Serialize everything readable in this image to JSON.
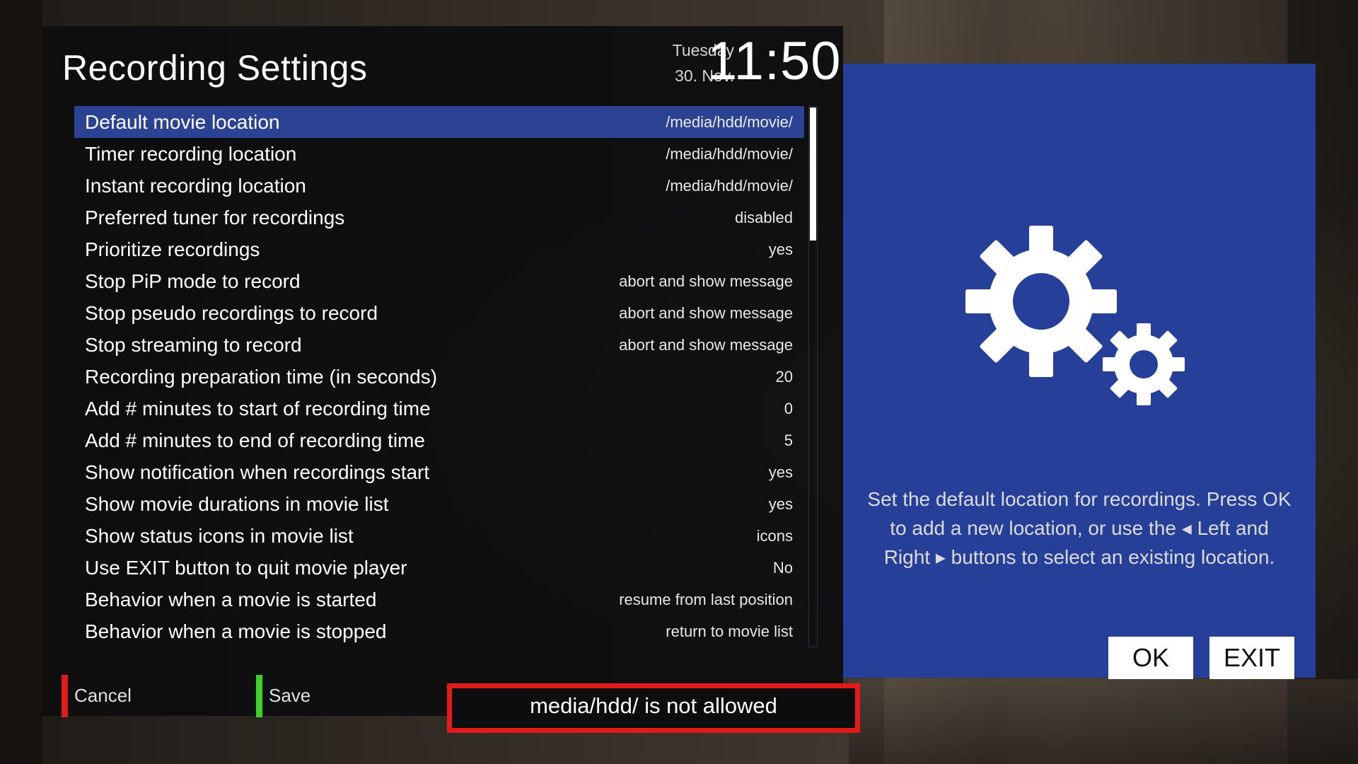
{
  "header": {
    "title": "Recording Settings",
    "day": "Tuesday",
    "date": "30. Nov.",
    "time": "11:50"
  },
  "settings": [
    {
      "label": "Default movie location",
      "value": "/media/hdd/movie/",
      "selected": true
    },
    {
      "label": "Timer recording location",
      "value": "/media/hdd/movie/"
    },
    {
      "label": "Instant recording location",
      "value": "/media/hdd/movie/"
    },
    {
      "label": "Preferred tuner for recordings",
      "value": "disabled"
    },
    {
      "label": "Prioritize recordings",
      "value": "yes"
    },
    {
      "label": "Stop PiP mode to record",
      "value": "abort and show message"
    },
    {
      "label": "Stop pseudo recordings to record",
      "value": "abort and show message"
    },
    {
      "label": "Stop streaming to record",
      "value": "abort and show message"
    },
    {
      "label": "Recording preparation time (in seconds)",
      "value": "20"
    },
    {
      "label": "Add # minutes to start of recording time",
      "value": "0"
    },
    {
      "label": "Add # minutes to end of recording time",
      "value": "5"
    },
    {
      "label": "Show notification when recordings start",
      "value": "yes"
    },
    {
      "label": "Show movie durations in movie list",
      "value": "yes"
    },
    {
      "label": "Show status icons in movie list",
      "value": "icons"
    },
    {
      "label": "Use EXIT button to quit movie player",
      "value": "No"
    },
    {
      "label": "Behavior when a movie is started",
      "value": "resume from last position"
    },
    {
      "label": "Behavior when a movie is stopped",
      "value": "return to movie list"
    }
  ],
  "footer": {
    "cancel_label": "Cancel",
    "cancel_color": "#e31a1a",
    "save_label": "Save",
    "save_color": "#3fd226",
    "error_message": "media/hdd/ is not allowed",
    "error_color": "#e31a1a"
  },
  "info": {
    "icon": "gears-icon",
    "help_text": "Set the default location for recordings. Press OK to add a new location, or use the ◂ Left and Right ▸ buttons to select an existing location.",
    "ok_label": "OK",
    "exit_label": "EXIT",
    "panel_color": "#26409a"
  },
  "colors": {
    "selection": "#2c4394"
  }
}
